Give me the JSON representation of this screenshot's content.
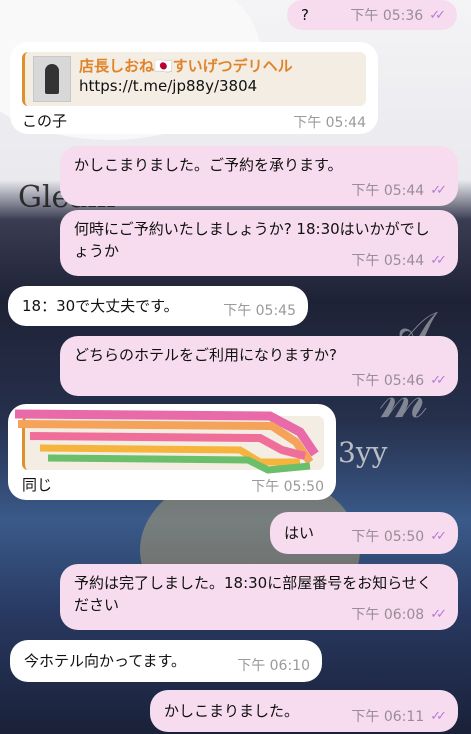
{
  "wallpaper": {
    "big_text": "Gleam",
    "glyphs": "𝒜 𝓂",
    "right_text": "3yy"
  },
  "messages": [
    {
      "id": "m1",
      "direction": "out",
      "text": "?",
      "time": "下午 05:36",
      "read": true
    },
    {
      "id": "m2",
      "direction": "in",
      "card": {
        "title": "店長しおね🇯🇵すいげつデリヘル",
        "url": "https://t.me/jp88y/3804",
        "thumb": "profile-photo"
      },
      "text": "この子",
      "time": "下午 05:44"
    },
    {
      "id": "m3",
      "direction": "out",
      "text": "かしこまりました。ご予約を承ります。",
      "time": "下午 05:44",
      "read": true
    },
    {
      "id": "m4",
      "direction": "out",
      "text": "何時にご予約いたしましょうか? 18:30はいかがでしょうか",
      "time": "下午 05:44",
      "read": true
    },
    {
      "id": "m5",
      "direction": "in",
      "text": "18：30で大丈夫です。",
      "time": "下午 05:45"
    },
    {
      "id": "m6",
      "direction": "out",
      "text": "どちらのホテルをご利用になりますか?",
      "time": "下午 05:46",
      "read": true
    },
    {
      "id": "m7",
      "direction": "in",
      "redacted": true,
      "text": "同じ",
      "time": "下午 05:50"
    },
    {
      "id": "m8",
      "direction": "out",
      "text": "はい",
      "time": "下午 05:50",
      "read": true
    },
    {
      "id": "m9",
      "direction": "out",
      "text": "予約は完了しました。18:30に部屋番号をお知らせください",
      "time": "下午 06:08",
      "read": true
    },
    {
      "id": "m10",
      "direction": "in",
      "text": "今ホテル向かってます。",
      "time": "下午 06:10"
    },
    {
      "id": "m11",
      "direction": "out",
      "text": "かしこまりました。",
      "time": "下午 06:11",
      "read": true
    }
  ],
  "colors": {
    "outgoing_bubble": "#f7dcef",
    "incoming_bubble": "#ffffff",
    "link_card_accent": "#e0902a",
    "read_ticks": "#b77bd1"
  }
}
